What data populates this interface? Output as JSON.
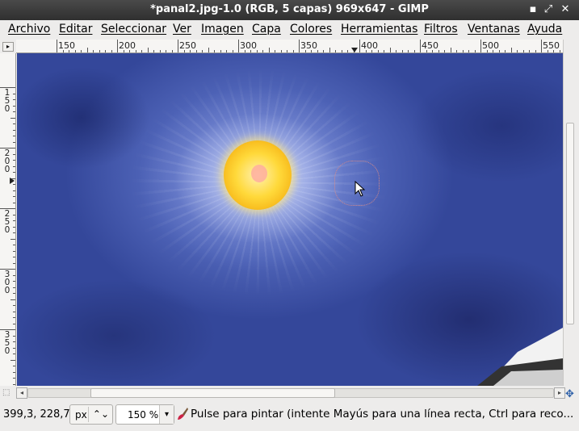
{
  "window": {
    "title": "*panal2.jpg-1.0 (RGB, 5 capas) 969x647 - GIMP"
  },
  "menu": [
    {
      "label": "Archivo"
    },
    {
      "label": "Editar"
    },
    {
      "label": "Seleccionar"
    },
    {
      "label": "Ver"
    },
    {
      "label": "Imagen"
    },
    {
      "label": "Capa"
    },
    {
      "label": "Colores"
    },
    {
      "label": "Herramientas"
    },
    {
      "label": "Filtros"
    },
    {
      "label": "Ventanas"
    },
    {
      "label": "Ayuda"
    }
  ],
  "ruler": {
    "h_labels": [
      "150",
      "200",
      "250",
      "300",
      "350",
      "400",
      "450",
      "500",
      "550"
    ],
    "v_labels": [
      "150",
      "200",
      "250",
      "300",
      "350"
    ]
  },
  "status": {
    "coords": "399,3, 228,7",
    "unit": "px",
    "zoom": "150 %",
    "message": "Pulse para pintar (intente Mayús para una línea recta, Ctrl para reco..."
  },
  "scroll": {
    "h_fraction": 0.46
  },
  "icons": {
    "cursor": "arrow-cursor-icon",
    "brush": "paintbrush-icon",
    "navigate": "navigate-icon",
    "quick_mask": "quick-mask-icon"
  }
}
